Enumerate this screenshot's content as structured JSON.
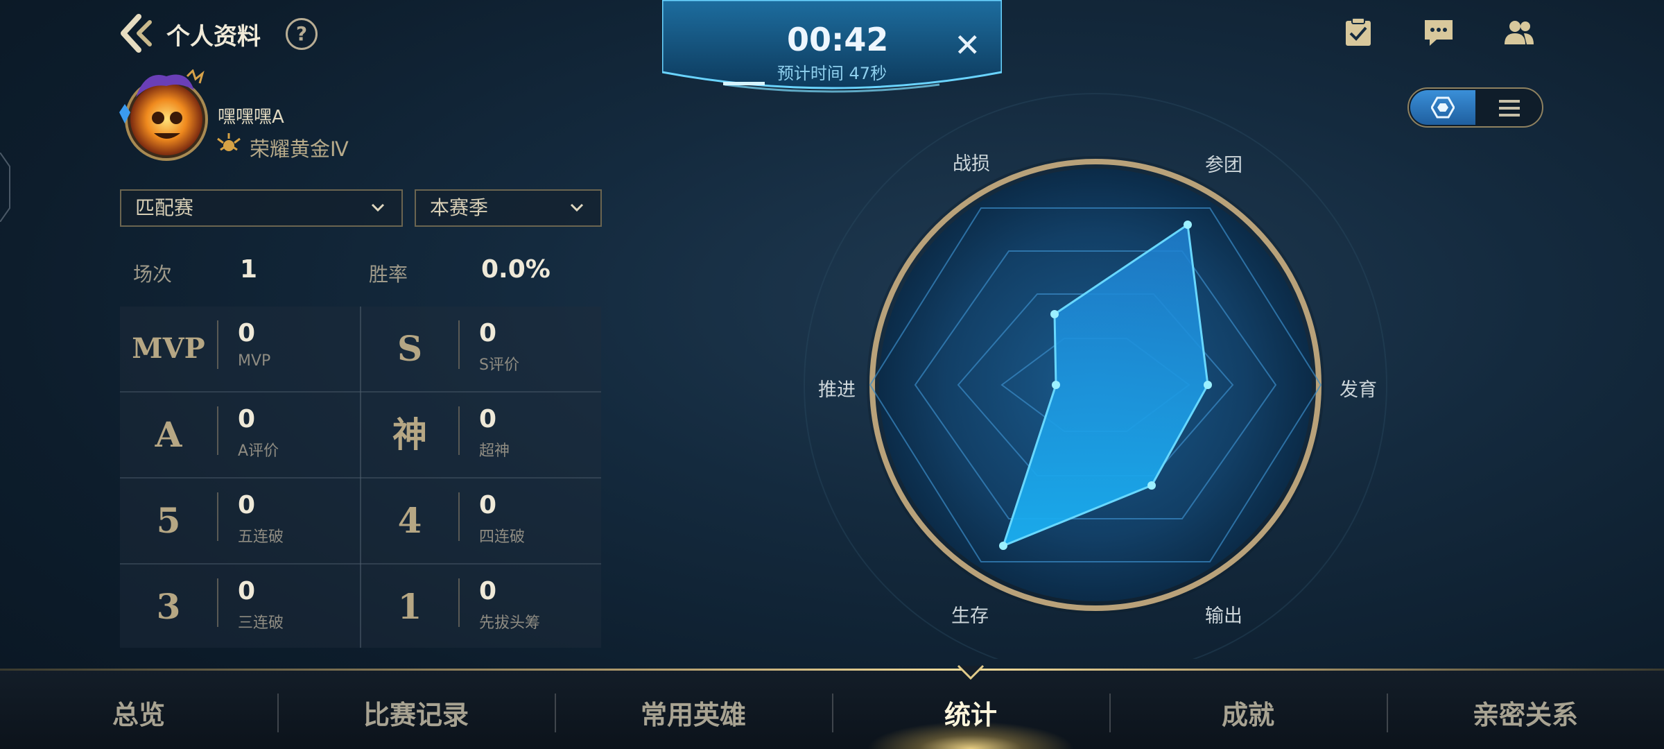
{
  "header": {
    "title": "个人资料",
    "help": "?"
  },
  "profile": {
    "username": "嘿嘿嘿A",
    "rank": "荣耀黄金Ⅳ"
  },
  "filters": {
    "mode": "匹配赛",
    "season": "本赛季"
  },
  "summary": {
    "games_label": "场次",
    "games_value": "1",
    "winrate_label": "胜率",
    "winrate_value": "0.0%"
  },
  "stats": [
    {
      "icon": "MVP",
      "value": "0",
      "label": "MVP"
    },
    {
      "icon": "S",
      "value": "0",
      "label": "S评价"
    },
    {
      "icon": "A",
      "value": "0",
      "label": "A评价"
    },
    {
      "icon": "神",
      "value": "0",
      "label": "超神"
    },
    {
      "icon": "5",
      "value": "0",
      "label": "五连破"
    },
    {
      "icon": "4",
      "value": "0",
      "label": "四连破"
    },
    {
      "icon": "3",
      "value": "0",
      "label": "三连破"
    },
    {
      "icon": "1",
      "value": "0",
      "label": "先拔头筹"
    }
  ],
  "timer": {
    "elapsed": "00:42",
    "estimate": "预计时间 47秒"
  },
  "radar": {
    "labels": {
      "top_left": "战损",
      "top_right": "参团",
      "right": "发育",
      "bottom_right": "输出",
      "bottom_left": "生存",
      "left": "推进"
    }
  },
  "nav": {
    "tabs": [
      "总览",
      "比赛记录",
      "常用英雄",
      "统计",
      "成就",
      "亲密关系"
    ],
    "active": "统计"
  },
  "colors": {
    "accent_gold": "#c7b68c",
    "radar_blue": "#1fa3ee"
  }
}
